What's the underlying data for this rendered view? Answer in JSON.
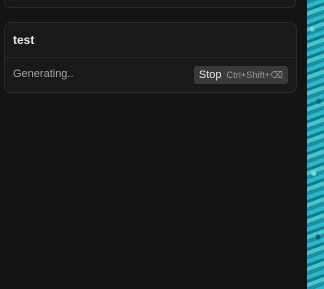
{
  "chat": {
    "card": {
      "title": "test",
      "status": "Generating..",
      "stop_label": "Stop",
      "stop_shortcut": "Ctrl+Shift+⌫"
    }
  },
  "colors": {
    "panel_bg": "#141414",
    "card_bg": "#191919",
    "border": "#2a2a2a",
    "button_bg": "#3a3a3a",
    "wallpaper_teal": "#2bb8c7"
  }
}
